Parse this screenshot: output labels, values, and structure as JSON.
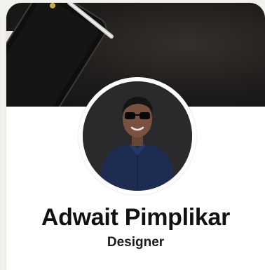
{
  "profile": {
    "name": "Adwait Pimplikar",
    "role": "Designer"
  },
  "cover": {
    "image": "desk-with-phone-and-pen-photo"
  },
  "avatar": {
    "image": "portrait-photo-man-sunglasses"
  },
  "colors": {
    "card_background": "#ffffff",
    "page_background": "#f3f1ec",
    "cover_dark": "#1e1c1a",
    "text_primary": "#111111"
  }
}
